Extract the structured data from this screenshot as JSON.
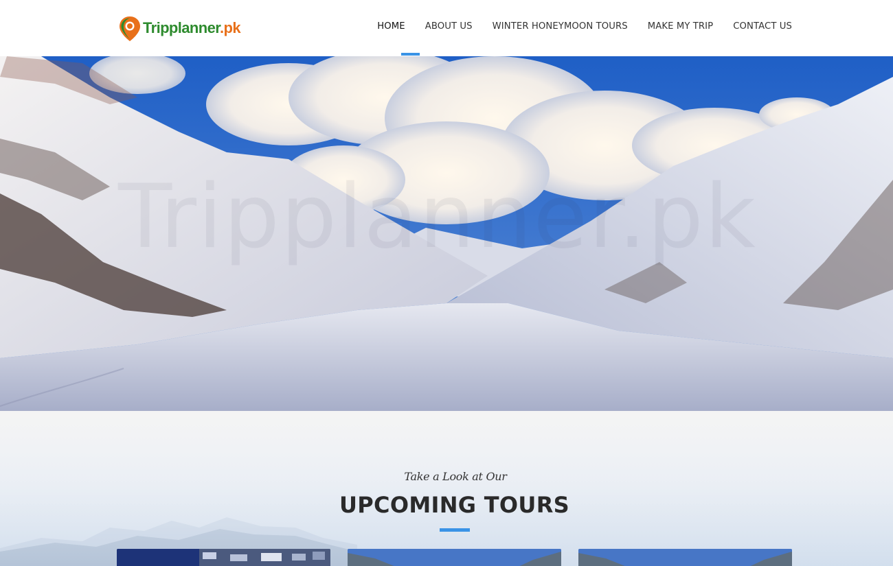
{
  "brand": {
    "name_main": "Tripplanner",
    "name_tld": ".pk"
  },
  "nav": {
    "items": [
      {
        "label": "HOME",
        "active": true
      },
      {
        "label": "ABOUT US",
        "active": false
      },
      {
        "label": "WINTER HONEYMOON TOURS",
        "active": false
      },
      {
        "label": "MAKE MY TRIP",
        "active": false
      },
      {
        "label": "CONTACT US",
        "active": false
      }
    ]
  },
  "hero": {
    "watermark": "Tripplanner.pk"
  },
  "tours": {
    "tagline": "Take a Look at Our",
    "title": "UPCOMING TOURS"
  },
  "colors": {
    "accent": "#3a93e6",
    "brand_green": "#2e8b2e",
    "brand_orange": "#e8701a"
  }
}
